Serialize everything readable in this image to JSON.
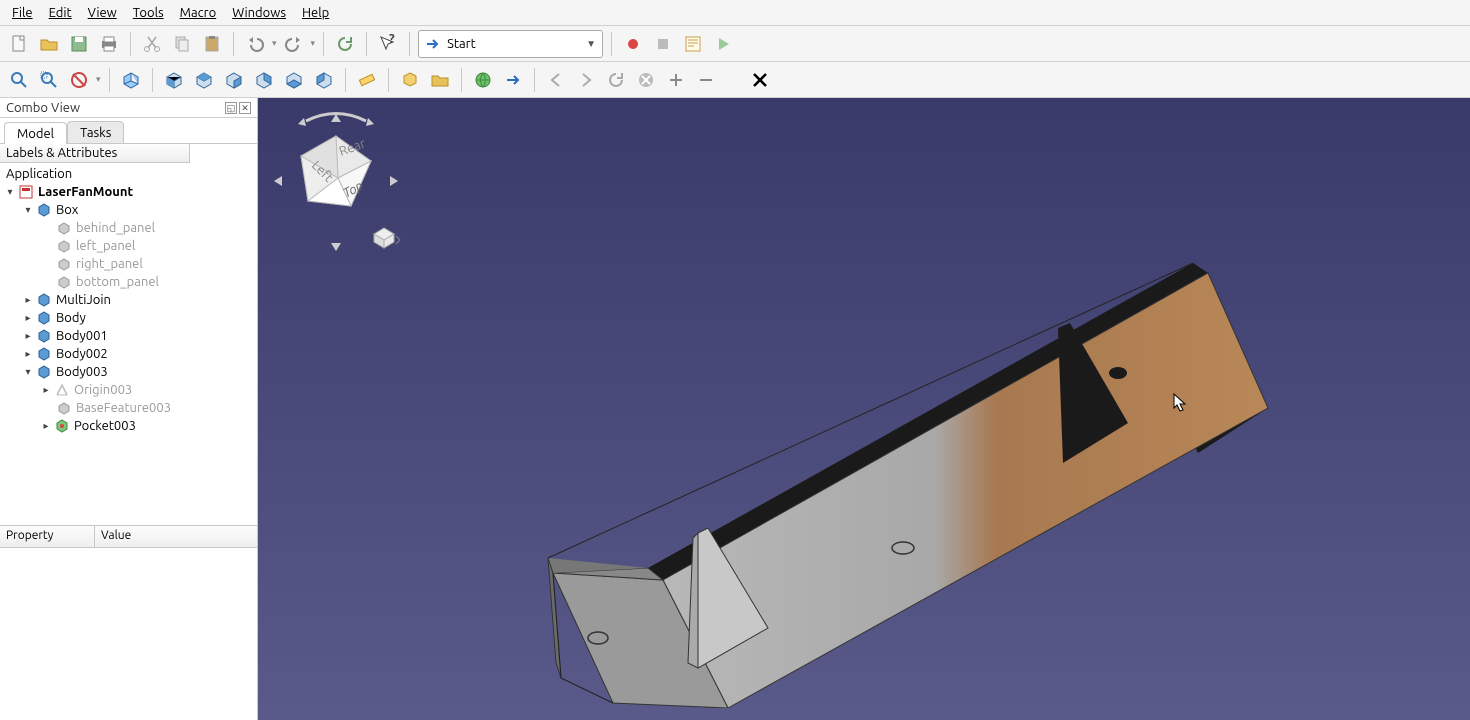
{
  "menu": {
    "file": "File",
    "edit": "Edit",
    "view": "View",
    "tools": "Tools",
    "macro": "Macro",
    "windows": "Windows",
    "help": "Help"
  },
  "workbench": {
    "label": "Start"
  },
  "combo": {
    "title": "Combo View",
    "tab_model": "Model",
    "tab_tasks": "Tasks",
    "labels_attrs": "Labels & Attributes"
  },
  "tree": {
    "application": "Application",
    "doc": "LaserFanMount",
    "box": "Box",
    "behind_panel": "behind_panel",
    "left_panel": "left_panel",
    "right_panel": "right_panel",
    "bottom_panel": "bottom_panel",
    "multijoin": "MultiJoin",
    "body": "Body",
    "body001": "Body001",
    "body002": "Body002",
    "body003": "Body003",
    "origin003": "Origin003",
    "basefeature003": "BaseFeature003",
    "pocket003": "Pocket003"
  },
  "property": {
    "col_prop": "Property",
    "col_val": "Value"
  },
  "navcube": {
    "face_top": "Top",
    "face_rear": "Rear",
    "face_left": "Left"
  },
  "icons": {
    "new": "new-document-icon",
    "open": "open-icon",
    "save": "save-icon",
    "print": "print-icon",
    "cut": "cut-icon",
    "copy": "copy-icon",
    "paste": "paste-icon",
    "undo": "undo-icon",
    "redo": "redo-icon",
    "refresh": "refresh-icon",
    "whatsthis": "whats-this-icon",
    "rec": "macro-record-icon",
    "stop": "macro-stop-icon",
    "macros": "macro-list-icon",
    "play": "macro-play-icon",
    "fit": "zoom-fit-icon",
    "fitsel": "zoom-selection-icon",
    "drawstyle": "draw-style-icon",
    "iso": "view-isometric-icon",
    "front": "view-front-icon",
    "top": "view-top-icon",
    "right": "view-right-icon",
    "rear": "view-rear-icon",
    "bottom": "view-bottom-icon",
    "left": "view-left-icon",
    "measure": "measure-icon",
    "part": "create-part-icon",
    "group": "create-group-icon",
    "web": "web-icon",
    "weblink": "set-url-icon",
    "back": "nav-back-icon",
    "fwd": "nav-forward-icon",
    "reload": "nav-refresh-icon",
    "stopnav": "nav-stop-icon",
    "zoomin": "zoom-in-icon",
    "zoomout": "zoom-out-icon",
    "close": "close-icon"
  }
}
